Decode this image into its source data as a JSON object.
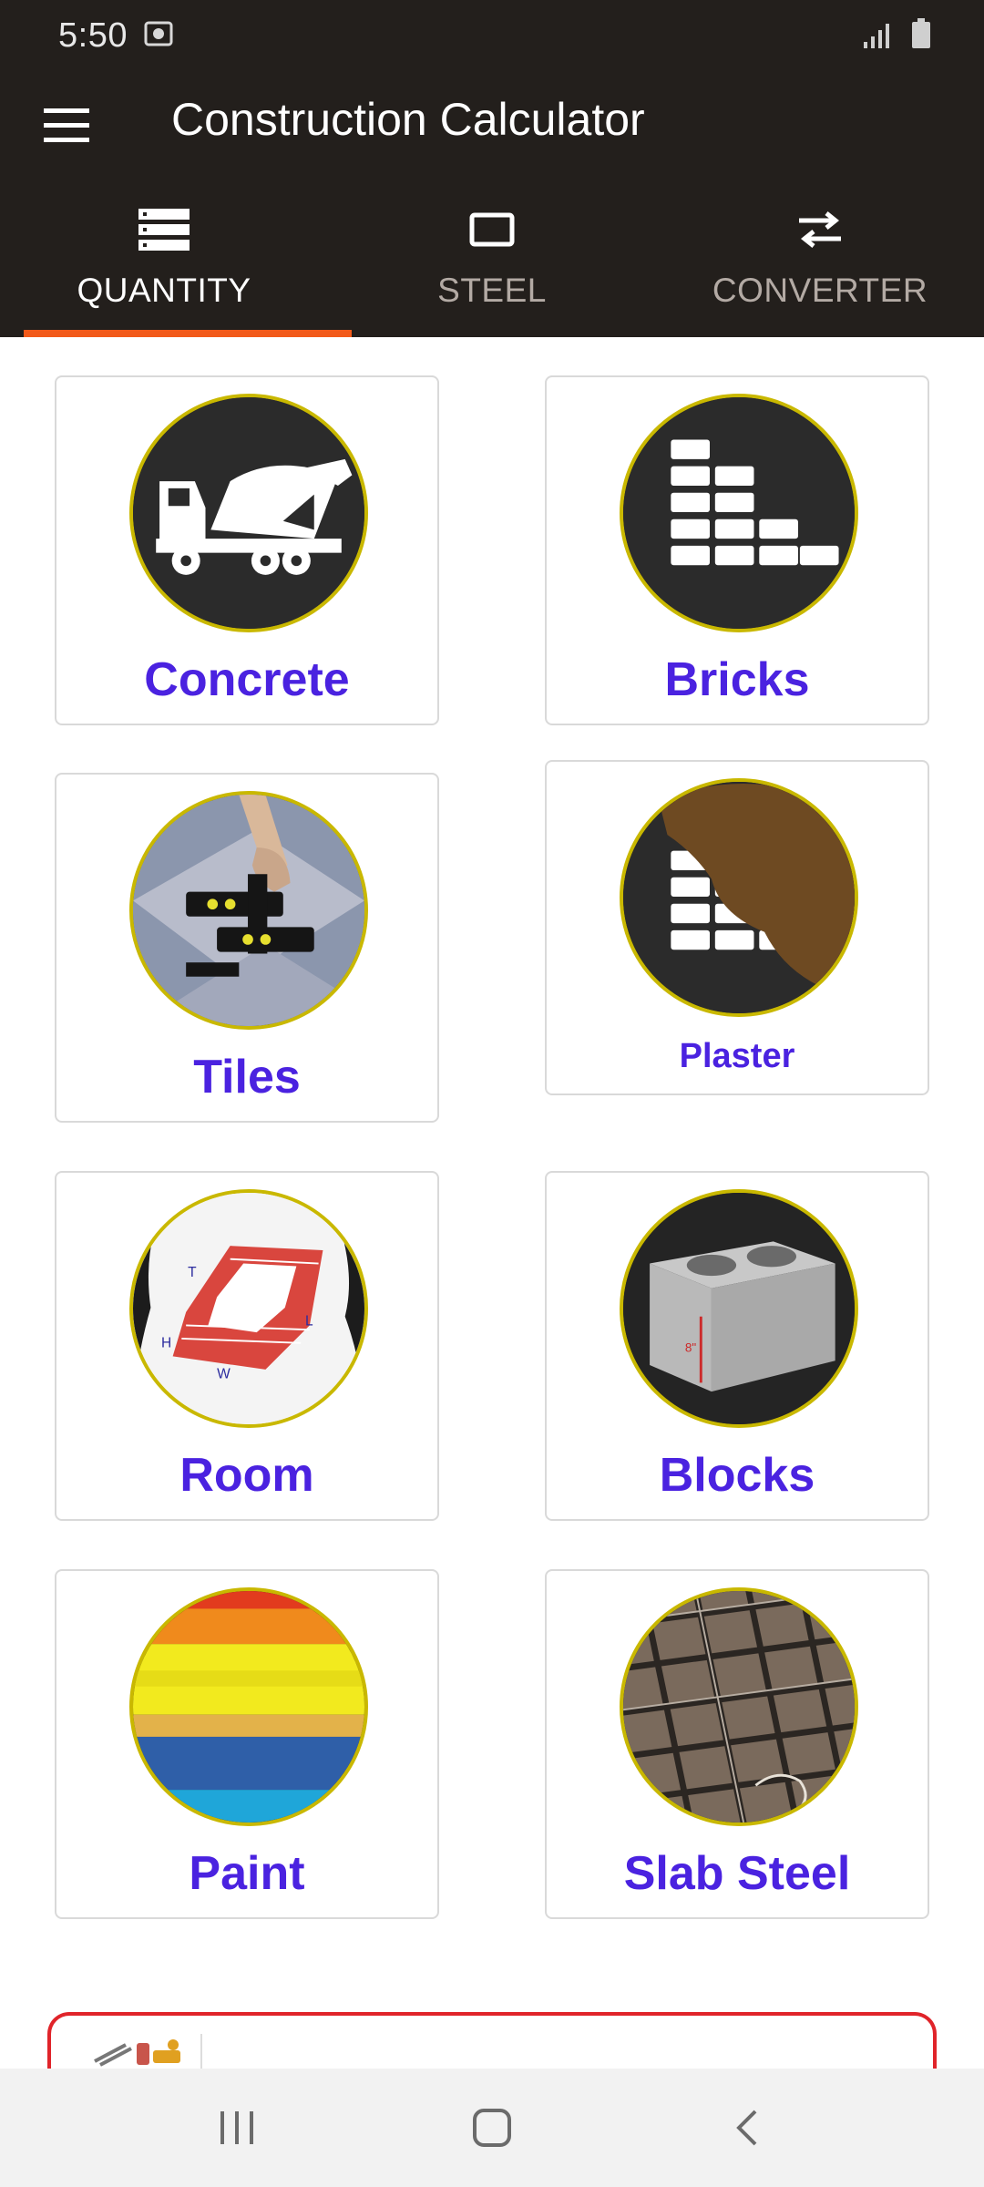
{
  "status_bar": {
    "time": "5:50"
  },
  "app_bar": {
    "title": "Construction Calculator"
  },
  "tabs": [
    {
      "label": "QUANTITY",
      "icon": "list-icon",
      "active": true
    },
    {
      "label": "STEEL",
      "icon": "rectangle-icon",
      "active": false
    },
    {
      "label": "CONVERTER",
      "icon": "swap-arrows-icon",
      "active": false
    }
  ],
  "cards": [
    {
      "label": "Concrete",
      "icon": "concrete-mixer-truck-icon"
    },
    {
      "label": "Bricks",
      "icon": "brick-stack-icon"
    },
    {
      "label": "Tiles",
      "icon": "tile-lifter-photo-icon"
    },
    {
      "label": "Plaster",
      "icon": "plaster-wall-icon"
    },
    {
      "label": "Room",
      "icon": "brick-room-diagram-icon",
      "diagram_labels": [
        "T",
        "L",
        "H",
        "W"
      ]
    },
    {
      "label": "Blocks",
      "icon": "concrete-block-photo-icon",
      "dimension_label": "8\""
    },
    {
      "label": "Paint",
      "icon": "paint-stripes-icon"
    },
    {
      "label": "Slab Steel",
      "icon": "rebar-mesh-photo-icon"
    }
  ],
  "colors": {
    "app_bar": "#231f1c",
    "tab_indicator": "#f25a1a",
    "card_label": "#4a22e0",
    "circle_border": "#c9b800",
    "ad_border": "#e0242a"
  }
}
